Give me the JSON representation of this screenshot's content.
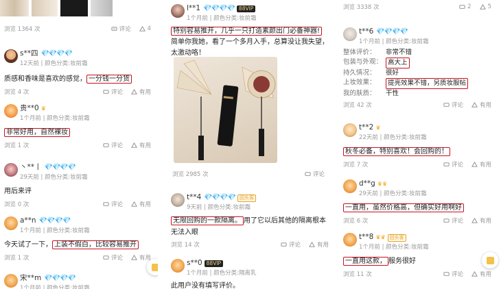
{
  "col1": {
    "top_views": "浏览 1364 次",
    "top_comment": "评论",
    "top_like": "4",
    "reviews": [
      {
        "user": "s**四",
        "meta": "12天前 | 颜色分类:妆前霜",
        "pre": "质感和香味是喜欢的感觉，",
        "hl": "一分钱一分货",
        "post": "",
        "views": "浏览 4 次",
        "comment": "评论",
        "useful": "有用"
      },
      {
        "user": "贵**0",
        "meta": "1个月前 | 颜色分类:妆前霜",
        "pre": "",
        "hl": "非常好用，自然裸妆",
        "post": "",
        "views": "浏览 1 次",
        "comment": "评论",
        "useful": "有用"
      },
      {
        "user": "丶**丨",
        "meta": "29天前 | 颜色分类:妆前霜",
        "pre": "用后来评",
        "hl": "",
        "post": "",
        "views": "浏览 0 次",
        "comment": "评论",
        "useful": "有用"
      },
      {
        "user": "a**n",
        "meta": "1个月前 | 颜色分类:妆前霜",
        "pre": "今天试了一下，",
        "hl": "上装不假白，比较容易推开",
        "post": "",
        "views": "浏览 1 次",
        "comment": "评论",
        "useful": "有用"
      },
      {
        "user": "宋**m",
        "meta": "1个月前 | 颜色分类:妆前霜",
        "pre": "",
        "hl": "",
        "post": "",
        "views": "",
        "comment": "",
        "useful": ""
      }
    ]
  },
  "col2": {
    "r1_user": "l**1",
    "r1_vip": "88VIP",
    "r1_meta": "1个月前 | 颜色分类:妆前霜",
    "r1_hl": "特别容易推开，几乎一只打造素颜出门必备神器!",
    "r1_post": " 简单你我她，看了一个多月入手，总算没让我失望，太激动咯！",
    "r1_views": "浏览 2985 次",
    "r1_comment": "评论",
    "r2_user": "t**4",
    "r2_badge": "回头客",
    "r2_meta": "9天前 | 颜色分类:妆前霜",
    "r2_hl": "无限回购的一款隔离。",
    "r2_post": "用了它以后其他的隔离根本无法入眼",
    "r2_views": "浏览 14 次",
    "r2_comment": "评论",
    "r2_useful": "有用",
    "r3_user": "s**0",
    "r3_vip": "88VIP",
    "r3_meta": "1个月前 | 颜色分类:隔离乳",
    "r3_text": "此用户没有填写评价。"
  },
  "col3": {
    "top_views": "浏览 3338 次",
    "top_comment": "2",
    "top_like": "5",
    "r1_user": "t**6",
    "r1_meta": "1个月前 | 颜色分类:妆前霜",
    "specs": [
      {
        "k": "整体评价：",
        "v": "非常不错",
        "hl": false
      },
      {
        "k": "包装与外观：",
        "v": "高大上",
        "hl": true
      },
      {
        "k": "持久情况：",
        "v": "很好",
        "hl": false
      },
      {
        "k": "上妆效果：",
        "v": "提亮效果不错，另质妆服帖",
        "hl": true
      },
      {
        "k": "我的肤质：",
        "v": "干性",
        "hl": false
      }
    ],
    "r1_views": "浏览 42 次",
    "r1_comment": "评论",
    "r1_useful": "有用",
    "r2_user": "t**2",
    "r2_meta": "22天前 | 颜色分类:妆前霜",
    "r2_hl": "秋冬必备，特别喜欢！会回购的！",
    "r2_views": "浏览 7 次",
    "r2_comment": "评论",
    "r2_useful": "有用",
    "r3_user": "d**g",
    "r3_meta": "29天前 | 颜色分类:妆前霜",
    "r3_hl": "一直用，虽然价格高，但确实好用啊好",
    "r3_views": "浏览 6 次",
    "r3_comment": "评论",
    "r3_useful": "有用",
    "r4_user": "t**8",
    "r4_badge": "回头客",
    "r4_meta": "1个月前 | 颜色分类:妆前霜",
    "r4_hl": "一直用这款，",
    "r4_post": "服务很好",
    "r4_views": "浏览 11 次",
    "r4_comment": "评论",
    "r4_useful": "有用"
  },
  "gems": "💎💎💎💎",
  "colors": {
    "highlight": "#c80f1e",
    "gem": "#33a9f0",
    "crown": "#f2a20a"
  }
}
